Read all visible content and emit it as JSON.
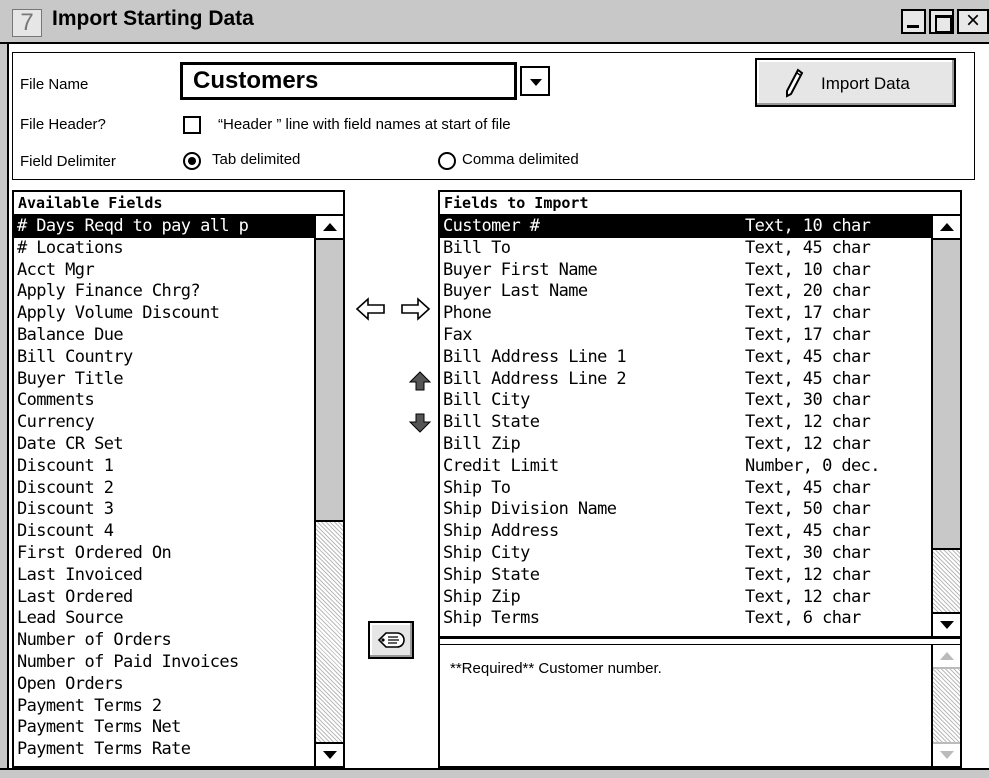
{
  "window": {
    "app_icon_glyph": "7",
    "title": "Import Starting Data"
  },
  "header": {
    "file_name_label": "File Name",
    "file_name_value": "Customers",
    "import_button_label": "Import Data",
    "file_header_label": "File Header?",
    "file_header_checked": false,
    "file_header_option_text": "“Header ” line with field names at start of file",
    "delimiter_label": "Field Delimiter",
    "delimiter_options": [
      {
        "label": "Tab delimited",
        "selected": true
      },
      {
        "label": "Comma delimited",
        "selected": false
      }
    ]
  },
  "available_fields": {
    "title": "Available Fields",
    "items": [
      "# Days Reqd to pay all p",
      "# Locations",
      "Acct Mgr",
      "Apply Finance Chrg?",
      "Apply Volume Discount",
      "Balance Due",
      "Bill Country",
      "Buyer Title",
      "Comments",
      "Currency",
      "Date CR Set",
      "Discount 1",
      "Discount 2",
      "Discount 3",
      "Discount 4",
      "First Ordered On",
      "Last Invoiced",
      "Last Ordered",
      "Lead Source",
      "Number of Orders",
      "Number of Paid Invoices",
      "Open Orders",
      "Payment Terms 2",
      "Payment Terms Net",
      "Payment Terms Rate"
    ],
    "selected_index": 0
  },
  "fields_to_import": {
    "title": "Fields to Import",
    "items": [
      {
        "name": "Customer #",
        "type": "Text, 10 char"
      },
      {
        "name": "Bill To",
        "type": "Text, 45 char"
      },
      {
        "name": "Buyer First Name",
        "type": "Text, 10 char"
      },
      {
        "name": "Buyer Last Name",
        "type": "Text, 20 char"
      },
      {
        "name": "Phone",
        "type": "Text, 17 char"
      },
      {
        "name": "Fax",
        "type": "Text, 17 char"
      },
      {
        "name": "Bill Address Line 1",
        "type": "Text, 45 char"
      },
      {
        "name": "Bill Address Line 2",
        "type": "Text, 45 char"
      },
      {
        "name": "Bill City",
        "type": "Text, 30 char"
      },
      {
        "name": "Bill State",
        "type": "Text, 12 char"
      },
      {
        "name": "Bill Zip",
        "type": "Text, 12 char"
      },
      {
        "name": "Credit Limit",
        "type": "Number, 0 dec."
      },
      {
        "name": "Ship To",
        "type": "Text, 45 char"
      },
      {
        "name": "Ship Division Name",
        "type": "Text, 50 char"
      },
      {
        "name": "Ship Address",
        "type": "Text, 45 char"
      },
      {
        "name": "Ship City",
        "type": "Text, 30 char"
      },
      {
        "name": "Ship State",
        "type": "Text, 12 char"
      },
      {
        "name": "Ship Zip",
        "type": "Text, 12 char"
      },
      {
        "name": "Ship Terms",
        "type": "Text, 6 char"
      }
    ],
    "selected_index": 0
  },
  "description": {
    "text": "**Required** Customer number."
  },
  "icons": {
    "move_left": "arrow-left-outline-icon",
    "move_right": "arrow-right-outline-icon",
    "move_up": "arrow-up-filled-icon",
    "move_down": "arrow-down-filled-icon",
    "tool": "hand-pointer-icon",
    "import": "pencil-icon"
  }
}
